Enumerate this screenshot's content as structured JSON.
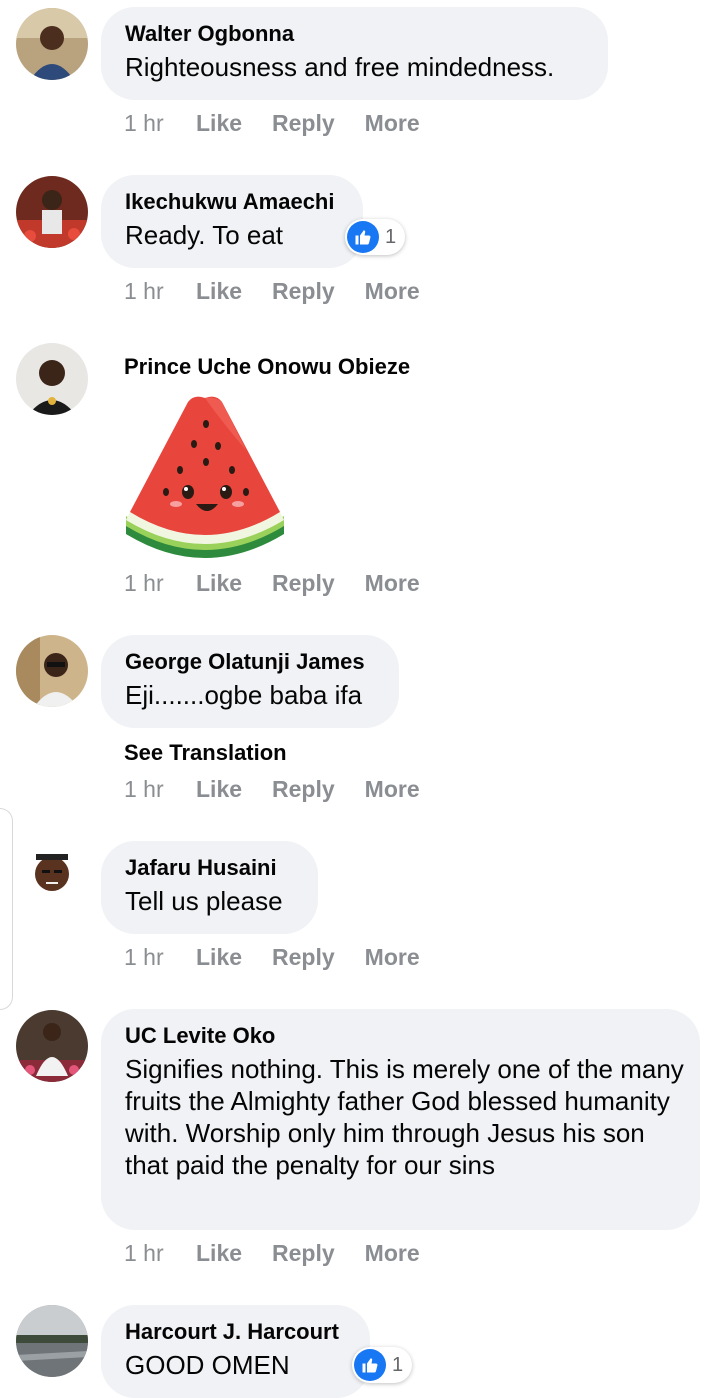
{
  "actions": {
    "time": "1 hr",
    "like": "Like",
    "reply": "Reply",
    "more": "More"
  },
  "accent": "#1877f2",
  "comments": [
    {
      "name": "Walter Ogbonna",
      "text": "Righteousness and free mindedness."
    },
    {
      "name": "Ikechukwu Amaechi",
      "text": "Ready. To eat",
      "reaction_count": "1",
      "reaction_icon": "thumbs-up-icon"
    },
    {
      "name": "Prince Uche Onowu Obieze",
      "sticker": "watermelon-sticker"
    },
    {
      "name": "George Olatunji James",
      "text": "Eji.......ogbe baba ifa",
      "see_translation": "See Translation"
    },
    {
      "name": "Jafaru Husaini",
      "text": "Tell us please"
    },
    {
      "name": "UC Levite Oko",
      "text": "Signifies nothing. This is merely one of the many fruits the Almighty father God blessed humanity with. Worship only him through Jesus his son that paid the penalty for our sins"
    },
    {
      "name": "Harcourt J. Harcourt",
      "text": "GOOD OMEN",
      "reaction_count": "1",
      "reaction_icon": "thumbs-up-icon"
    }
  ]
}
